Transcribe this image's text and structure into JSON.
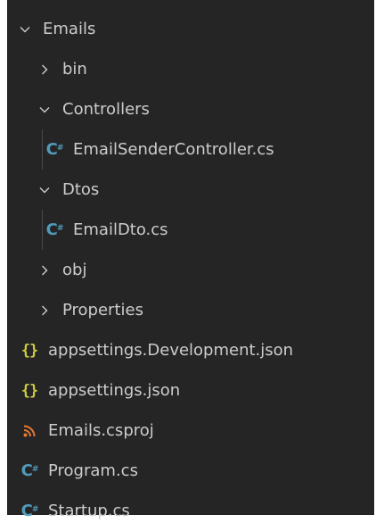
{
  "explorer": {
    "root": {
      "label": "Emails",
      "icon": "chevron-down-icon",
      "expanded": true
    },
    "items": [
      {
        "label": "bin",
        "type": "folder",
        "expanded": false,
        "icon": "chevron-right-icon"
      },
      {
        "label": "Controllers",
        "type": "folder",
        "expanded": true,
        "icon": "chevron-down-icon"
      },
      {
        "label": "EmailSenderController.cs",
        "type": "file",
        "icon": "csharp-file-icon"
      },
      {
        "label": "Dtos",
        "type": "folder",
        "expanded": true,
        "icon": "chevron-down-icon"
      },
      {
        "label": "EmailDto.cs",
        "type": "file",
        "icon": "csharp-file-icon"
      },
      {
        "label": "obj",
        "type": "folder",
        "expanded": false,
        "icon": "chevron-right-icon"
      },
      {
        "label": "Properties",
        "type": "folder",
        "expanded": false,
        "icon": "chevron-right-icon"
      },
      {
        "label": "appsettings.Development.json",
        "type": "file",
        "icon": "json-file-icon"
      },
      {
        "label": "appsettings.json",
        "type": "file",
        "icon": "json-file-icon"
      },
      {
        "label": "Emails.csproj",
        "type": "file",
        "icon": "rss-file-icon"
      },
      {
        "label": "Program.cs",
        "type": "file",
        "icon": "csharp-file-icon"
      },
      {
        "label": "Startup.cs",
        "type": "file",
        "icon": "csharp-file-icon"
      }
    ]
  },
  "colors": {
    "background": "#252526",
    "text": "#cccccc",
    "csharp_icon": "#519aba",
    "json_icon": "#cbcb41",
    "rss_icon": "#e37933",
    "indent_guide": "#4a4a4a"
  }
}
